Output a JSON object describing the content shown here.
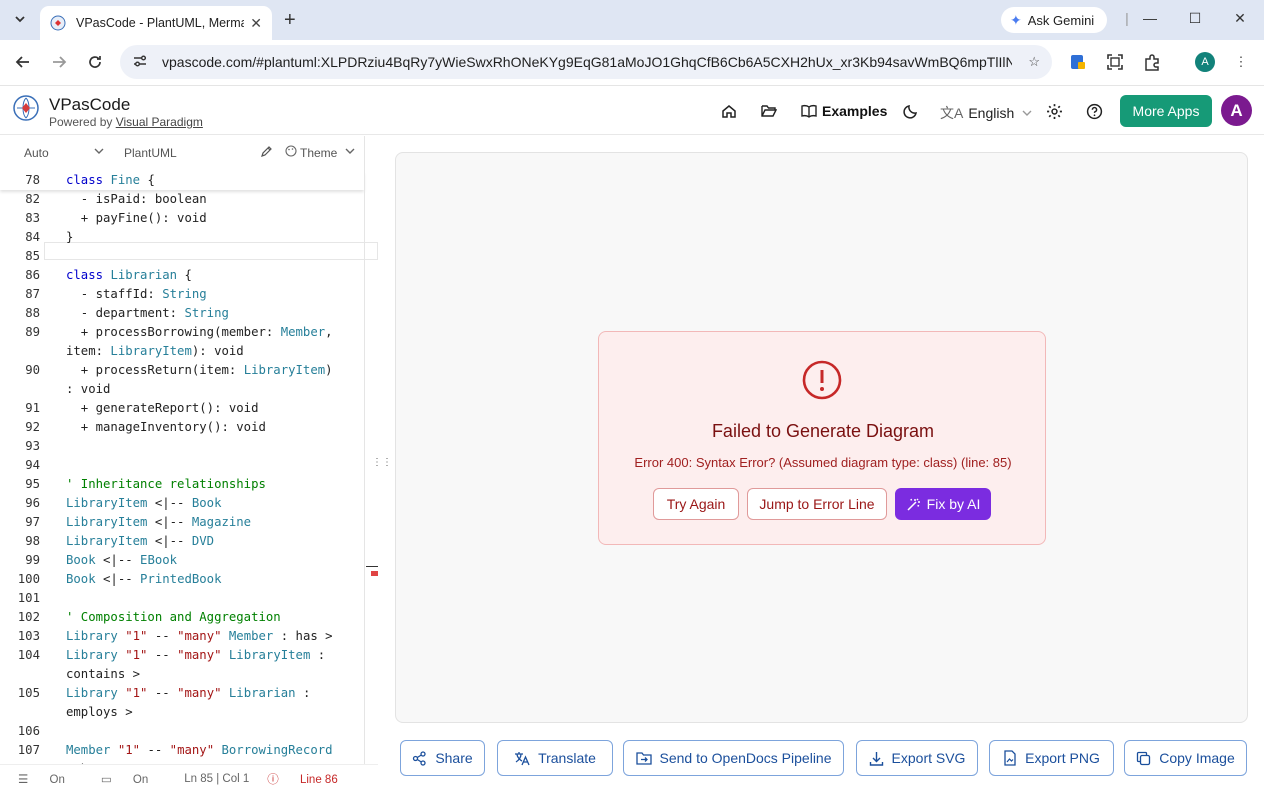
{
  "browser": {
    "tab_title": "VPasCode - PlantUML, Mermaid",
    "url": "vpascode.com/#plantuml:XLPDRziu4BqRy7yWieSwxRhONeKYg9EqG81aMoJO1GhqCfB6Cb6A5CXH2hUx_xr3Kb94savWmBQ6mpTlIlN14L...",
    "gemini_label": "Ask Gemini",
    "profile_initial": "A"
  },
  "app": {
    "brand": "VPasCode",
    "powered_prefix": "Powered by ",
    "powered_link": "Visual Paradigm",
    "examples_label": "Examples",
    "language": "English",
    "more_apps": "More Apps",
    "avatar_initial": "A"
  },
  "editor": {
    "mode_select": "Auto",
    "lang_label": "PlantUML",
    "theme_label": "Theme",
    "status": {
      "wrap": "On",
      "minimap": "On",
      "cursor": "Ln 85 | Col 1",
      "error": "Line 86"
    }
  },
  "error": {
    "title": "Failed to Generate Diagram",
    "message": "Error 400: Syntax Error? (Assumed diagram type: class) (line: 85)",
    "try_again": "Try Again",
    "jump": "Jump to Error Line",
    "fix": "Fix by AI"
  },
  "actions": {
    "share": "Share",
    "translate": "Translate",
    "opendocs": "Send to OpenDocs Pipeline",
    "export_svg": "Export SVG",
    "export_png": "Export PNG",
    "copy_image": "Copy Image"
  },
  "code_lines": [
    {
      "n": "78",
      "html": "<span class='kw'>class</span> <span class='ty'>Fine</span> {"
    },
    {
      "n": "82",
      "html": "  - isPaid: boolean"
    },
    {
      "n": "83",
      "html": "  + payFine(): void"
    },
    {
      "n": "84",
      "html": "}"
    },
    {
      "n": "85",
      "html": ""
    },
    {
      "n": "86",
      "html": "<span class='kw'>class</span> <span class='ty'>Librarian</span> {"
    },
    {
      "n": "87",
      "html": "  - staffId: <span class='ty'>String</span>"
    },
    {
      "n": "88",
      "html": "  - department: <span class='ty'>String</span>"
    },
    {
      "n": "89",
      "html": "  + processBorrowing(member: <span class='ty'>Member</span>,"
    },
    {
      "n": "",
      "html": "item: <span class='ty'>LibraryItem</span>): void"
    },
    {
      "n": "90",
      "html": "  + processReturn(item: <span class='ty'>LibraryItem</span>)"
    },
    {
      "n": "",
      "html": ": void"
    },
    {
      "n": "91",
      "html": "  + generateReport(): void"
    },
    {
      "n": "92",
      "html": "  + manageInventory(): void"
    },
    {
      "n": "93",
      "html": ""
    },
    {
      "n": "94",
      "html": ""
    },
    {
      "n": "95",
      "html": "<span class='cm'>' Inheritance relationships</span>"
    },
    {
      "n": "96",
      "html": "<span class='ty'>LibraryItem</span> &lt;|-- <span class='ty'>Book</span>"
    },
    {
      "n": "97",
      "html": "<span class='ty'>LibraryItem</span> &lt;|-- <span class='ty'>Magazine</span>"
    },
    {
      "n": "98",
      "html": "<span class='ty'>LibraryItem</span> &lt;|-- <span class='ty'>DVD</span>"
    },
    {
      "n": "99",
      "html": "<span class='ty'>Book</span> &lt;|-- <span class='ty'>EBook</span>"
    },
    {
      "n": "100",
      "html": "<span class='ty'>Book</span> &lt;|-- <span class='ty'>PrintedBook</span>"
    },
    {
      "n": "101",
      "html": ""
    },
    {
      "n": "102",
      "html": "<span class='cm'>' Composition and Aggregation</span>"
    },
    {
      "n": "103",
      "html": "<span class='ty'>Library</span> <span class='str'>\"1\"</span> -- <span class='str'>\"many\"</span> <span class='ty'>Member</span> : has &gt;"
    },
    {
      "n": "104",
      "html": "<span class='ty'>Library</span> <span class='str'>\"1\"</span> -- <span class='str'>\"many\"</span> <span class='ty'>LibraryItem</span> :"
    },
    {
      "n": "",
      "html": "contains &gt;"
    },
    {
      "n": "105",
      "html": "<span class='ty'>Library</span> <span class='str'>\"1\"</span> -- <span class='str'>\"many\"</span> <span class='ty'>Librarian</span> :"
    },
    {
      "n": "",
      "html": "employs &gt;"
    },
    {
      "n": "106",
      "html": ""
    },
    {
      "n": "107",
      "html": "<span class='ty'>Member</span> <span class='str'>\"1\"</span> -- <span class='str'>\"many\"</span> <span class='ty'>BorrowingRecord</span>"
    },
    {
      "n": "",
      "html": ": has &gt;"
    }
  ]
}
